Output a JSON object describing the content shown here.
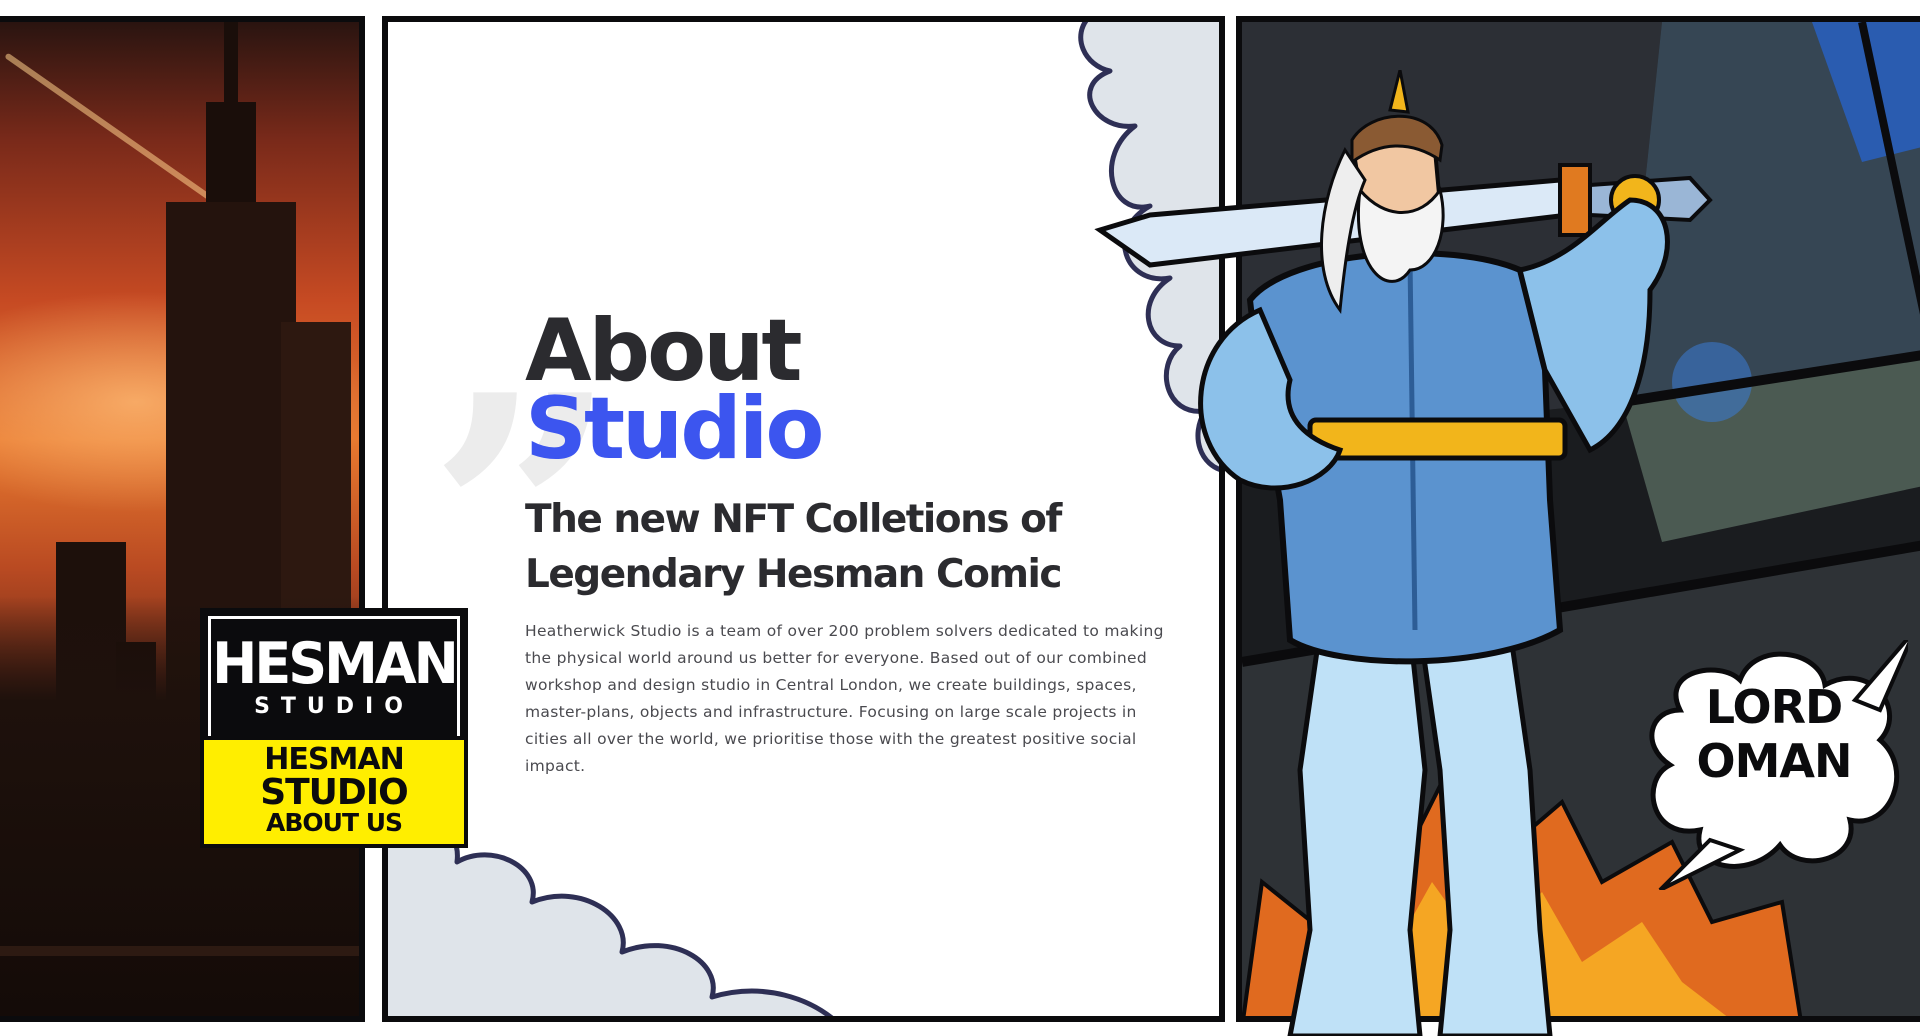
{
  "about": {
    "title_line1": "About",
    "title_line2": "Studio",
    "subtitle": "The new NFT Colletions of Legendary Hesman Comic",
    "description": "Heatherwick Studio is a team of over 200 problem solvers dedicated to making the physical world around us better for everyone. Based out of our combined workshop and design studio in Central London, we create buildings, spaces, master-plans, objects and infrastructure. Focusing on large scale projects in cities all over the world, we prioritise those with the greatest positive social impact."
  },
  "logo_badge": {
    "logo_word": "HESMAN",
    "logo_sub": "STUDIO",
    "line1": "HESMAN",
    "line2": "STUDIO",
    "line3": "ABOUT US"
  },
  "character": {
    "speech_line1": "LORD",
    "speech_line2": "OMAN"
  },
  "colors": {
    "accent_blue": "#3c55ef",
    "badge_yellow": "#ffee00",
    "ink": "#0b0b0d",
    "cloud_fill": "#dfe4ea",
    "cloud_stroke": "#2e2f55"
  },
  "icons": [
    "quote-icon"
  ]
}
